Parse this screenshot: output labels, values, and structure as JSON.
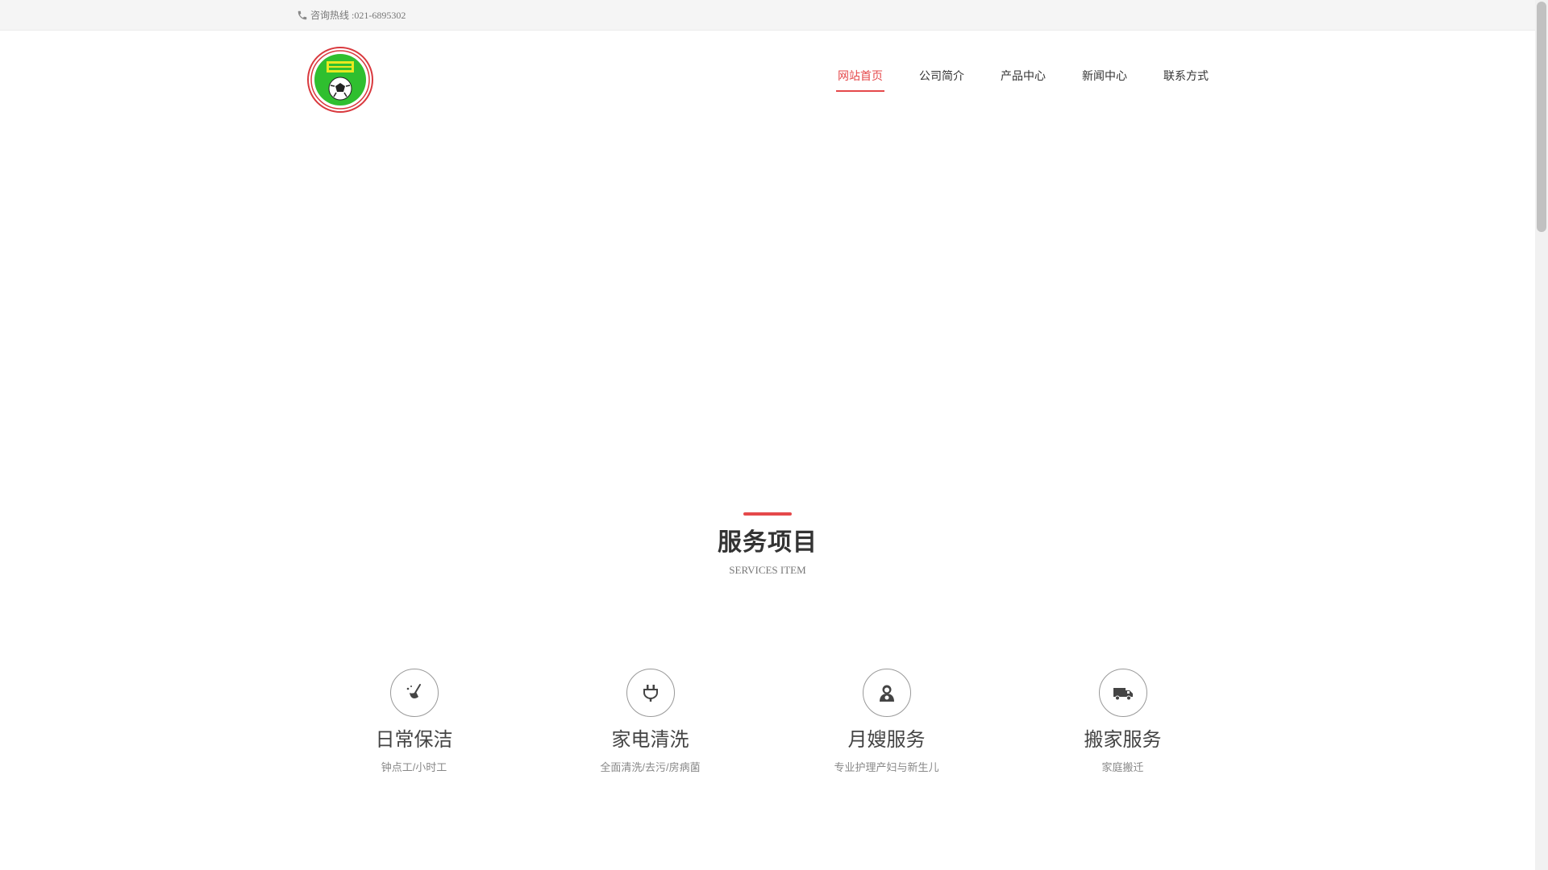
{
  "topbar": {
    "hotline": "咨询热线 :021-6895302",
    "phone_icon": "phone-icon"
  },
  "header": {
    "logo_icon": "club-badge-logo",
    "nav": [
      {
        "label": "网站首页",
        "active": true
      },
      {
        "label": "公司简介",
        "active": false
      },
      {
        "label": "产品中心",
        "active": false
      },
      {
        "label": "新闻中心",
        "active": false
      },
      {
        "label": "联系方式",
        "active": false
      }
    ]
  },
  "section": {
    "title": "服务项目",
    "subtitle": "SERVICES ITEM"
  },
  "services": [
    {
      "name": "日常保洁",
      "desc": "钟点工/小时工",
      "icon": "broom-icon"
    },
    {
      "name": "家电清洗",
      "desc": "全面清洗/去污/房病菌",
      "icon": "plug-icon"
    },
    {
      "name": "月嫂服务",
      "desc": "专业护理产妇与新生儿",
      "icon": "nanny-icon"
    },
    {
      "name": "搬家服务",
      "desc": "家庭搬迁",
      "icon": "truck-icon"
    }
  ],
  "colors": {
    "accent": "#e5494b",
    "topbar_bg": "#f5f5f5",
    "text": "#333333"
  }
}
